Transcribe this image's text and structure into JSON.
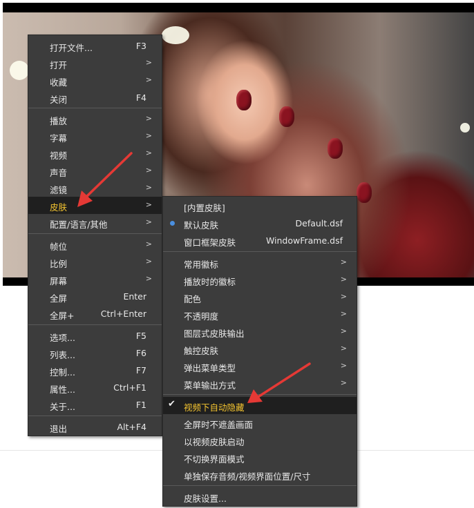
{
  "main_menu": {
    "items": [
      {
        "label": "打开文件...",
        "shortcut": "F3"
      },
      {
        "label": "打开",
        "arrow": ">"
      },
      {
        "label": "收藏",
        "arrow": ">"
      },
      {
        "label": "关闭",
        "shortcut": "F4"
      },
      {
        "label": "播放",
        "arrow": ">"
      },
      {
        "label": "字幕",
        "arrow": ">"
      },
      {
        "label": "视频",
        "arrow": ">"
      },
      {
        "label": "声音",
        "arrow": ">"
      },
      {
        "label": "滤镜",
        "arrow": ">"
      },
      {
        "label": "皮肤",
        "arrow": ">"
      },
      {
        "label": "配置/语言/其他",
        "arrow": ">"
      },
      {
        "label": "帧位",
        "arrow": ">"
      },
      {
        "label": "比例",
        "arrow": ">"
      },
      {
        "label": "屏幕",
        "arrow": ">"
      },
      {
        "label": "全屏",
        "shortcut": "Enter"
      },
      {
        "label": "全屏+",
        "shortcut": "Ctrl+Enter"
      },
      {
        "label": "选项...",
        "shortcut": "F5"
      },
      {
        "label": "列表...",
        "shortcut": "F6"
      },
      {
        "label": "控制...",
        "shortcut": "F7"
      },
      {
        "label": "属性...",
        "shortcut": "Ctrl+F1"
      },
      {
        "label": "关于...",
        "shortcut": "F1"
      },
      {
        "label": "退出",
        "shortcut": "Alt+F4"
      }
    ]
  },
  "skin_menu": {
    "items": [
      {
        "label": "[内置皮肤]"
      },
      {
        "label": "默认皮肤",
        "value": "Default.dsf",
        "selected": true
      },
      {
        "label": "窗口框架皮肤",
        "value": "WindowFrame.dsf"
      },
      {
        "label": "常用徽标",
        "arrow": ">"
      },
      {
        "label": "播放时的徽标",
        "arrow": ">"
      },
      {
        "label": "配色",
        "arrow": ">"
      },
      {
        "label": "不透明度",
        "arrow": ">"
      },
      {
        "label": "图层式皮肤输出",
        "arrow": ">"
      },
      {
        "label": "触控皮肤",
        "arrow": ">"
      },
      {
        "label": "弹出菜单类型",
        "arrow": ">"
      },
      {
        "label": "菜单输出方式",
        "arrow": ">"
      },
      {
        "label": "视频下自动隐藏",
        "checked": true
      },
      {
        "label": "全屏时不遮盖画面"
      },
      {
        "label": "以视频皮肤启动"
      },
      {
        "label": "不切换界面模式"
      },
      {
        "label": "单独保存音频/视频界面位置/尺寸"
      },
      {
        "label": "皮肤设置..."
      }
    ]
  },
  "colors": {
    "menu_bg": "#3c3c3c",
    "highlight_bg": "#1f1f1f",
    "highlight_text": "#f4c430",
    "annotation_arrow": "#e53935",
    "radio_accent": "#4a8fe0"
  }
}
